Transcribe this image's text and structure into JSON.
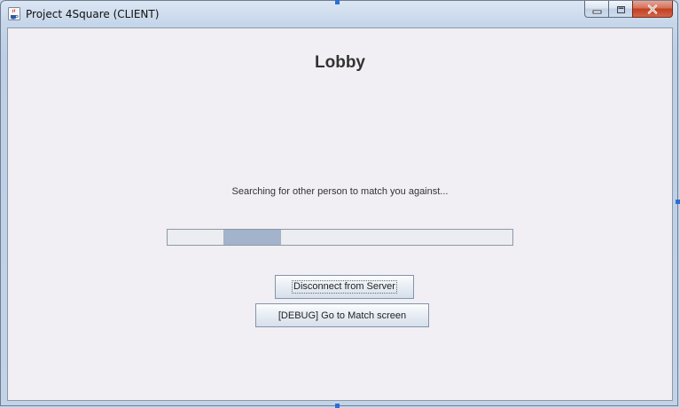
{
  "window": {
    "title": "Project 4Square (CLIENT)",
    "app_icon": "java-coffee-cup-icon",
    "caption_buttons": [
      "minimize-icon",
      "maximize-icon",
      "close-icon"
    ]
  },
  "lobby": {
    "heading": "Lobby",
    "status_text": "Searching for other person to match you against...",
    "progress": {
      "indeterminate": true
    },
    "buttons": {
      "disconnect_label": "Disconnect from Server",
      "debug_label": "[DEBUG] Go to Match screen"
    }
  }
}
